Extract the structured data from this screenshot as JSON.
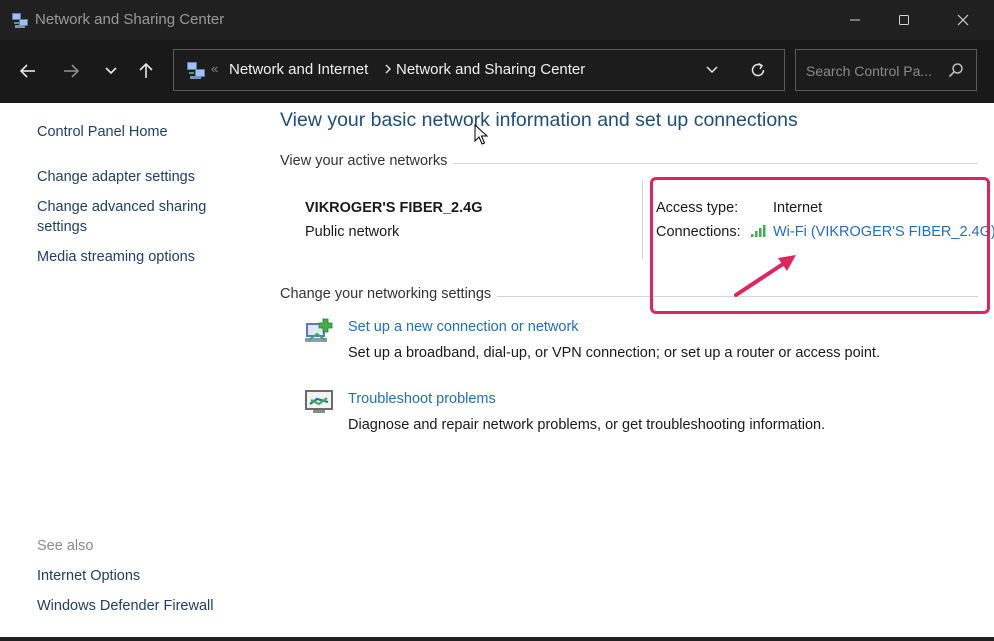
{
  "window": {
    "title": "Network and Sharing Center"
  },
  "address_bar": {
    "overflow": "«",
    "crumbs": [
      "Network and Internet",
      "Network and Sharing Center"
    ]
  },
  "search": {
    "placeholder": "Search Control Pa..."
  },
  "sidebar": {
    "home": "Control Panel Home",
    "links": [
      "Change adapter settings",
      "Change advanced sharing",
      "settings",
      "Media streaming options"
    ],
    "see_also_label": "See also",
    "see_also": [
      "Internet Options",
      "Windows Defender Firewall"
    ]
  },
  "main": {
    "heading": "View your basic network information and set up connections",
    "active_networks_label": "View your active networks",
    "network": {
      "name": "VIKROGER'S FIBER_2.4G",
      "category": "Public network",
      "access_type_label": "Access type:",
      "access_type_value": "Internet",
      "connections_label": "Connections:",
      "connection_link": "Wi-Fi (VIKROGER'S FIBER_2.4G)"
    },
    "change_settings_label": "Change your networking settings",
    "tasks": [
      {
        "title": "Set up a new connection or network",
        "description": "Set up a broadband, dial-up, or VPN connection; or set up a router or access point.",
        "icon": "new-connection-icon"
      },
      {
        "title": "Troubleshoot problems",
        "description": "Diagnose and repair network problems, or get troubleshooting information.",
        "icon": "troubleshoot-icon"
      }
    ]
  },
  "colors": {
    "annotation": "#e0245e",
    "link": "#1f6fbf",
    "heading": "#1e4e79"
  }
}
